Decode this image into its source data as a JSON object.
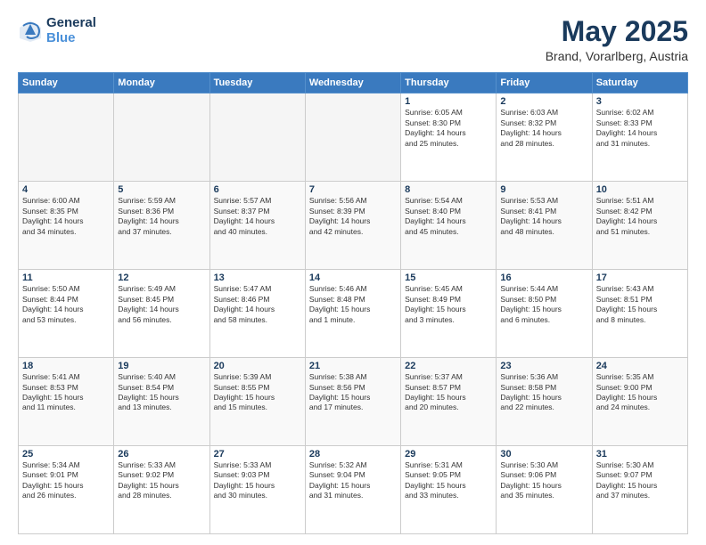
{
  "header": {
    "logo_line1": "General",
    "logo_line2": "Blue",
    "month": "May 2025",
    "location": "Brand, Vorarlberg, Austria"
  },
  "weekdays": [
    "Sunday",
    "Monday",
    "Tuesday",
    "Wednesday",
    "Thursday",
    "Friday",
    "Saturday"
  ],
  "weeks": [
    [
      {
        "day": "",
        "info": ""
      },
      {
        "day": "",
        "info": ""
      },
      {
        "day": "",
        "info": ""
      },
      {
        "day": "",
        "info": ""
      },
      {
        "day": "1",
        "info": "Sunrise: 6:05 AM\nSunset: 8:30 PM\nDaylight: 14 hours\nand 25 minutes."
      },
      {
        "day": "2",
        "info": "Sunrise: 6:03 AM\nSunset: 8:32 PM\nDaylight: 14 hours\nand 28 minutes."
      },
      {
        "day": "3",
        "info": "Sunrise: 6:02 AM\nSunset: 8:33 PM\nDaylight: 14 hours\nand 31 minutes."
      }
    ],
    [
      {
        "day": "4",
        "info": "Sunrise: 6:00 AM\nSunset: 8:35 PM\nDaylight: 14 hours\nand 34 minutes."
      },
      {
        "day": "5",
        "info": "Sunrise: 5:59 AM\nSunset: 8:36 PM\nDaylight: 14 hours\nand 37 minutes."
      },
      {
        "day": "6",
        "info": "Sunrise: 5:57 AM\nSunset: 8:37 PM\nDaylight: 14 hours\nand 40 minutes."
      },
      {
        "day": "7",
        "info": "Sunrise: 5:56 AM\nSunset: 8:39 PM\nDaylight: 14 hours\nand 42 minutes."
      },
      {
        "day": "8",
        "info": "Sunrise: 5:54 AM\nSunset: 8:40 PM\nDaylight: 14 hours\nand 45 minutes."
      },
      {
        "day": "9",
        "info": "Sunrise: 5:53 AM\nSunset: 8:41 PM\nDaylight: 14 hours\nand 48 minutes."
      },
      {
        "day": "10",
        "info": "Sunrise: 5:51 AM\nSunset: 8:42 PM\nDaylight: 14 hours\nand 51 minutes."
      }
    ],
    [
      {
        "day": "11",
        "info": "Sunrise: 5:50 AM\nSunset: 8:44 PM\nDaylight: 14 hours\nand 53 minutes."
      },
      {
        "day": "12",
        "info": "Sunrise: 5:49 AM\nSunset: 8:45 PM\nDaylight: 14 hours\nand 56 minutes."
      },
      {
        "day": "13",
        "info": "Sunrise: 5:47 AM\nSunset: 8:46 PM\nDaylight: 14 hours\nand 58 minutes."
      },
      {
        "day": "14",
        "info": "Sunrise: 5:46 AM\nSunset: 8:48 PM\nDaylight: 15 hours\nand 1 minute."
      },
      {
        "day": "15",
        "info": "Sunrise: 5:45 AM\nSunset: 8:49 PM\nDaylight: 15 hours\nand 3 minutes."
      },
      {
        "day": "16",
        "info": "Sunrise: 5:44 AM\nSunset: 8:50 PM\nDaylight: 15 hours\nand 6 minutes."
      },
      {
        "day": "17",
        "info": "Sunrise: 5:43 AM\nSunset: 8:51 PM\nDaylight: 15 hours\nand 8 minutes."
      }
    ],
    [
      {
        "day": "18",
        "info": "Sunrise: 5:41 AM\nSunset: 8:53 PM\nDaylight: 15 hours\nand 11 minutes."
      },
      {
        "day": "19",
        "info": "Sunrise: 5:40 AM\nSunset: 8:54 PM\nDaylight: 15 hours\nand 13 minutes."
      },
      {
        "day": "20",
        "info": "Sunrise: 5:39 AM\nSunset: 8:55 PM\nDaylight: 15 hours\nand 15 minutes."
      },
      {
        "day": "21",
        "info": "Sunrise: 5:38 AM\nSunset: 8:56 PM\nDaylight: 15 hours\nand 17 minutes."
      },
      {
        "day": "22",
        "info": "Sunrise: 5:37 AM\nSunset: 8:57 PM\nDaylight: 15 hours\nand 20 minutes."
      },
      {
        "day": "23",
        "info": "Sunrise: 5:36 AM\nSunset: 8:58 PM\nDaylight: 15 hours\nand 22 minutes."
      },
      {
        "day": "24",
        "info": "Sunrise: 5:35 AM\nSunset: 9:00 PM\nDaylight: 15 hours\nand 24 minutes."
      }
    ],
    [
      {
        "day": "25",
        "info": "Sunrise: 5:34 AM\nSunset: 9:01 PM\nDaylight: 15 hours\nand 26 minutes."
      },
      {
        "day": "26",
        "info": "Sunrise: 5:33 AM\nSunset: 9:02 PM\nDaylight: 15 hours\nand 28 minutes."
      },
      {
        "day": "27",
        "info": "Sunrise: 5:33 AM\nSunset: 9:03 PM\nDaylight: 15 hours\nand 30 minutes."
      },
      {
        "day": "28",
        "info": "Sunrise: 5:32 AM\nSunset: 9:04 PM\nDaylight: 15 hours\nand 31 minutes."
      },
      {
        "day": "29",
        "info": "Sunrise: 5:31 AM\nSunset: 9:05 PM\nDaylight: 15 hours\nand 33 minutes."
      },
      {
        "day": "30",
        "info": "Sunrise: 5:30 AM\nSunset: 9:06 PM\nDaylight: 15 hours\nand 35 minutes."
      },
      {
        "day": "31",
        "info": "Sunrise: 5:30 AM\nSunset: 9:07 PM\nDaylight: 15 hours\nand 37 minutes."
      }
    ]
  ]
}
